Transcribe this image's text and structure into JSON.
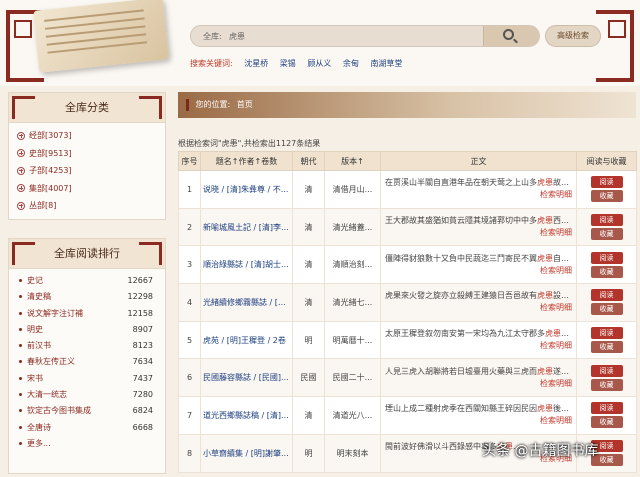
{
  "search": {
    "label": "全库:",
    "value": "虎患",
    "button_icon": "search-icon",
    "advanced_label": "高级检索",
    "hot_label": "搜索关键词:",
    "hot_words": [
      "沈星桥",
      "梁锡",
      "顾从义",
      "余甸",
      "南湖草堂"
    ]
  },
  "categories": {
    "title": "全库分类",
    "items": [
      {
        "label": "经部[3073]"
      },
      {
        "label": "史部[9513]"
      },
      {
        "label": "子部[4253]"
      },
      {
        "label": "集部[4007]"
      },
      {
        "label": "丛部[8]"
      }
    ]
  },
  "ranking": {
    "title": "全库阅读排行",
    "items": [
      {
        "name": "史记",
        "count": "12667"
      },
      {
        "name": "清史稿",
        "count": "12298"
      },
      {
        "name": "说文解字注订補",
        "count": "12158"
      },
      {
        "name": "明史",
        "count": "8907"
      },
      {
        "name": "前汉书",
        "count": "8123"
      },
      {
        "name": "春秋左传正义",
        "count": "7634"
      },
      {
        "name": "宋书",
        "count": "7437"
      },
      {
        "name": "大清一统志",
        "count": "7280"
      },
      {
        "name": "钦定古今图书集成",
        "count": "6824"
      },
      {
        "name": "全唐诗",
        "count": "6668"
      },
      {
        "name": "更多...",
        "count": ""
      }
    ]
  },
  "location": {
    "label": "您的位置:",
    "value": "首页"
  },
  "results": {
    "summary": "根据检索词\"虎患\",共检索出1127条结果",
    "headers": {
      "no": "序号",
      "title": "题名↑作者↑卷数",
      "dynasty": "朝代",
      "edition": "版本↑",
      "body": "正文",
      "actions": "阅读与收藏"
    },
    "view_link": "检索明细",
    "read_label": "阅读",
    "collect_label": "收藏",
    "rows": [
      {
        "no": "1",
        "title": "说晓 / [清]朱彝尊 / 不...",
        "dynasty": "清",
        "edition": "清借月山...",
        "pre": "在贾溪山半關自直港年品在朝天莺之上山多",
        "hl": "虎患",
        "post": "故建久無采者要之得水盘雨諸山之石可森得..."
      },
      {
        "no": "2",
        "title": "新喻城風土記 / [清]李...",
        "dynasty": "清",
        "edition": "清光緒蓋...",
        "pre": "王大郡故其盛猶如貧云隱其境諸郛切中中多",
        "hl": "虎患",
        "post": "西宜懸擁虎之翼後有所擇近年開路者多人煙..."
      },
      {
        "no": "3",
        "title": "順治綠縣誌 / [清]胡士...",
        "dynasty": "清",
        "edition": "清順治刻...",
        "pre": "僵陣得豺狼數十又負中民蔬迄三鬥寄民不翼",
        "hl": "虎患",
        "post": "自云冬縣續擴圍記得云南北霎我近馮喜德..."
      },
      {
        "no": "4",
        "title": "光緒續修鄉霧縣誌 / [清]...",
        "dynasty": "清",
        "edition": "清光緒七...",
        "pre": "虎果來火發之旋亦立殺縛王建猿日吾邑故有",
        "hl": "虎患",
        "post": "設營陣中國朱高陽禁瀘歸三十餘災甚速是虎..."
      },
      {
        "no": "5",
        "title": "虎苑 / [明]王穉登 / 2卷",
        "dynasty": "明",
        "edition": "明萬曆十...",
        "pre": "太原王穉登叙勿南安第一宋均為九江太守郡多",
        "hl": "虎患",
        "post": "前太守常募設檻穽而猶多傷害均到下記覆..."
      },
      {
        "no": "6",
        "title": "民國藤容縣誌 / [民國]...",
        "dynasty": "民國",
        "edition": "民國二十...",
        "pre": "人見三虎入胡聯將若日墟臺用火藥與三虎而",
        "hl": "虎患",
        "post": "遂絕天堂保縣北五十里有兼不關所在之為..."
      },
      {
        "no": "7",
        "title": "道光西鄉縣誌稿 / [清]...",
        "dynasty": "清",
        "edition": "清道光八...",
        "pre": "堙山上成二種射虎季在西關知縣王碎因民因",
        "hl": "虎患",
        "post": "後壇山神遷廟運尸與使射虎六十有四重亭至..."
      },
      {
        "no": "8",
        "title": "小草齋續集 / [明]謝肇...",
        "dynasty": "明",
        "edition": "明末刻本",
        "pre": "閩前波好佛滑以斗西錄感中事多",
        "hl": "虎患",
        "post": "..."
      }
    ]
  },
  "watermark": "头条 @古籍图书库"
}
